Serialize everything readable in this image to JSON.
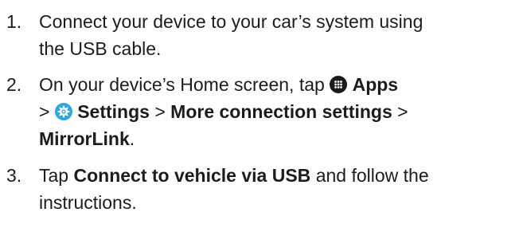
{
  "steps": [
    {
      "number": "1.",
      "line1": "Connect your device to your car’s system using",
      "line2": "the USB cable."
    },
    {
      "number": "2.",
      "intro": "On your device’s Home screen, tap",
      "apps_label": "Apps",
      "sep1": ">",
      "settings_label": "Settings",
      "sep2": ">",
      "more_connection_label": "More connection settings",
      "sep3": ">",
      "mirrorlink_label": "MirrorLink",
      "end_period": "."
    },
    {
      "number": "3.",
      "intro": "Tap",
      "connect_label": "Connect to vehicle via USB",
      "outro_line1": "and follow the",
      "outro_line2": "instructions."
    }
  ],
  "icons": {
    "apps": "apps-grid-icon",
    "settings": "settings-gear-icon"
  },
  "colors": {
    "text": "#1c1c1c",
    "apps_icon_bg": "#1b1b1b",
    "settings_icon_bg": "#2ea6e0"
  }
}
